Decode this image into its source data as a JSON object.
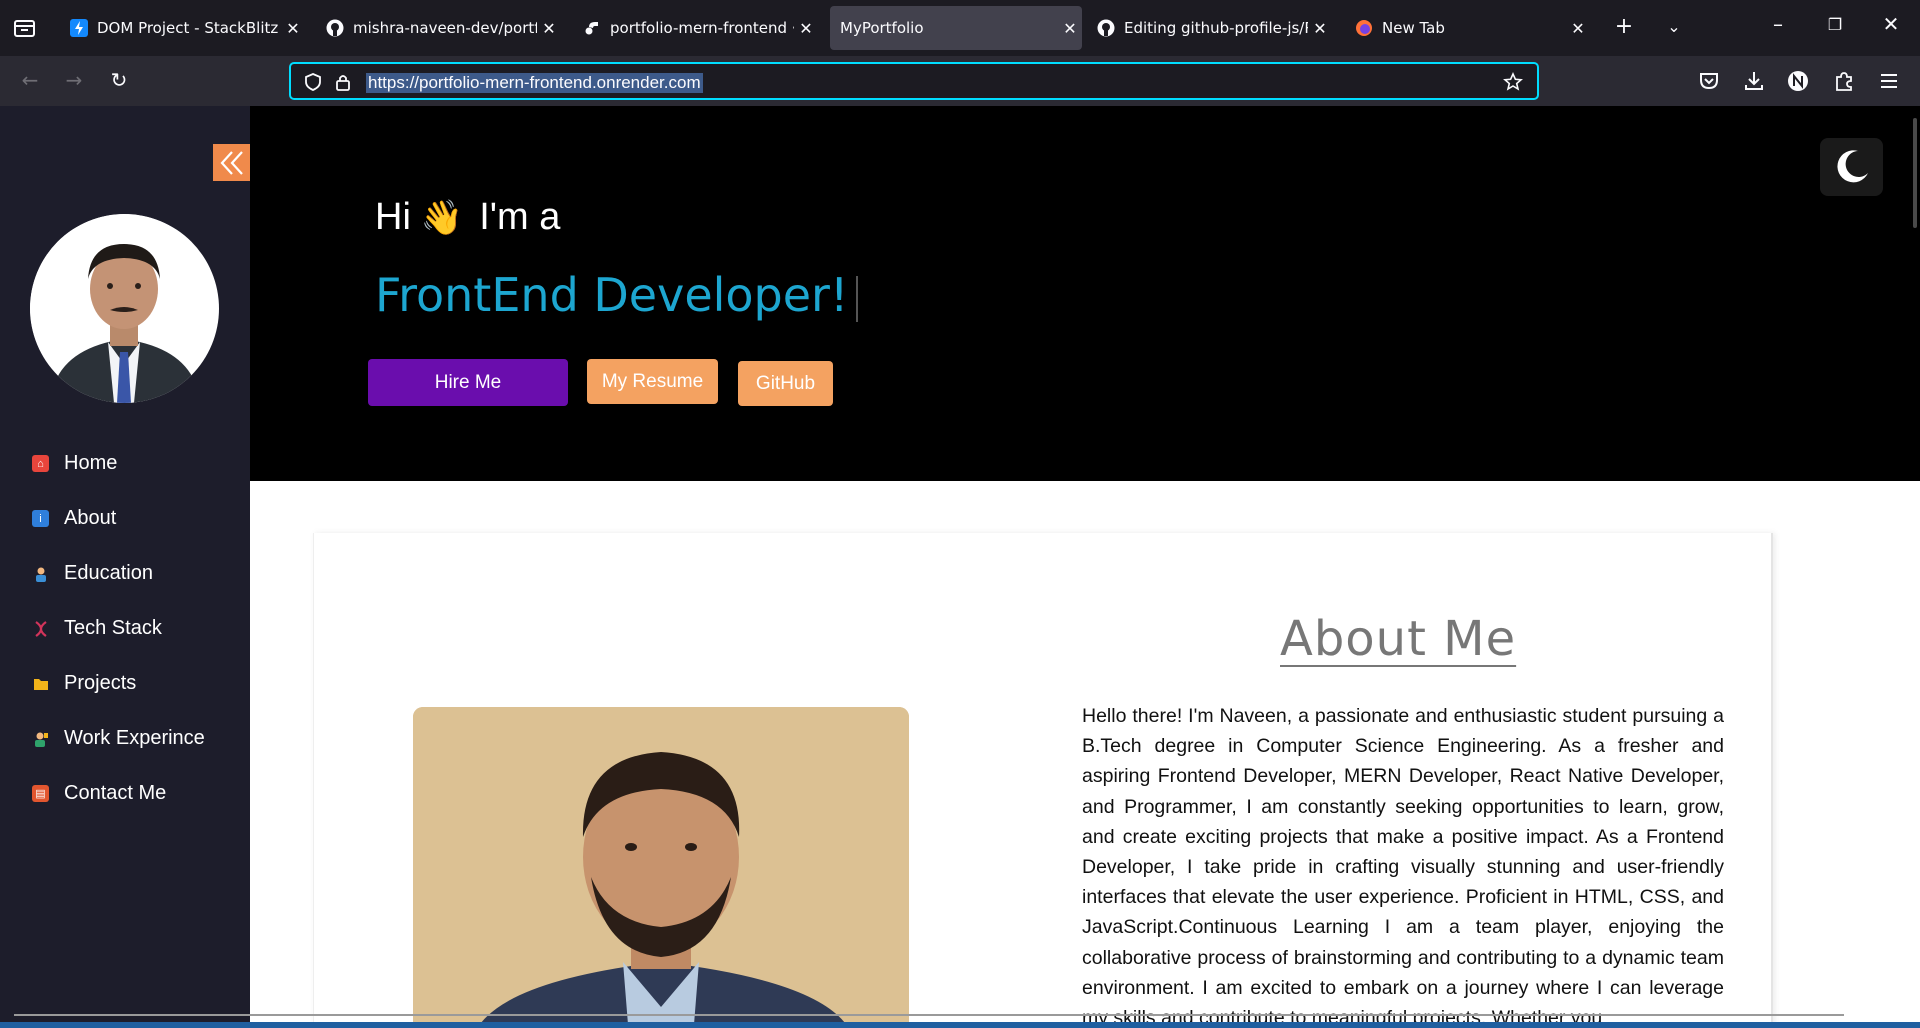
{
  "browser": {
    "tabs": [
      {
        "title": "DOM Project - StackBlitz",
        "icon": "stackblitz-icon",
        "active": false
      },
      {
        "title": "mishra-naveen-dev/portfolio",
        "icon": "github-icon",
        "active": false
      },
      {
        "title": "portfolio-mern-frontend ·",
        "icon": "render-icon",
        "active": false
      },
      {
        "title": "MyPortfolio",
        "icon": "",
        "active": true
      },
      {
        "title": "Editing github-profile-js/Re",
        "icon": "github-icon",
        "active": false
      },
      {
        "title": "New Tab",
        "icon": "firefox-icon",
        "active": false
      }
    ],
    "url": "https://portfolio-mern-frontend.onrender.com"
  },
  "sidebar": {
    "items": [
      {
        "label": "Home",
        "icon": "home-icon",
        "color": "#e8453c"
      },
      {
        "label": "About",
        "icon": "info-icon",
        "color": "#2f7fdc"
      },
      {
        "label": "Education",
        "icon": "student-icon",
        "color": "#3a8fd6"
      },
      {
        "label": "Tech Stack",
        "icon": "dna-icon",
        "color": "#d2345b"
      },
      {
        "label": "Projects",
        "icon": "folder-icon",
        "color": "#f2b31a"
      },
      {
        "label": "Work Experince",
        "icon": "worker-icon",
        "color": "#2fa36b"
      },
      {
        "label": "Contact Me",
        "icon": "contact-icon",
        "color": "#e2562f"
      }
    ]
  },
  "hero": {
    "greeting": "Hi",
    "wave": "👋",
    "intro": "I'm a",
    "role": "FrontEnd Developer!",
    "buttons": {
      "hire": "Hire Me",
      "resume": "My Resume",
      "github": "GitHub"
    }
  },
  "about": {
    "title": "About Me",
    "text": "Hello there! I'm Naveen, a passionate and enthusiastic student pursuing a B.Tech degree in Computer Science Engineering. As a fresher and aspiring Frontend Developer, MERN Developer, React Native Developer, and Programmer, I am constantly seeking opportunities to learn, grow, and create exciting projects that make a positive impact. As a Frontend Developer, I take pride in crafting visually stunning and user-friendly interfaces that elevate the user experience. Proficient in HTML, CSS, and JavaScript.Continuous Learning I am a team player, enjoying the collaborative process of brainstorming and contributing to a dynamic team environment. I am excited to embark on a journey where I can leverage my skills and contribute to meaningful projects. Whether you"
  },
  "colors": {
    "accent_orange": "#f4a261",
    "hire_purple": "#6a0dad",
    "role_blue": "#1da6d0",
    "sidebar_bg": "#1d1d2b"
  }
}
